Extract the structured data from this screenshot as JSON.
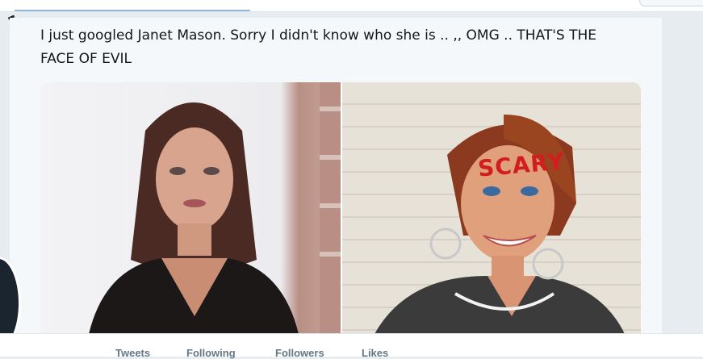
{
  "tweet": {
    "text_line1": "I just googled Janet Mason. Sorry I didn't know who she is .. ,, OMG .. THAT'S THE",
    "text_line2": "FACE OF EVIL",
    "image_overlay_text": "SCARY"
  },
  "profile_nav": {
    "tabs": [
      "Tweets",
      "Following",
      "Followers",
      "Likes"
    ]
  },
  "colors": {
    "page_background": "#e6ecf0",
    "tweet_text": "#14171a",
    "secondary_text": "#657786",
    "overlay_red": "#d11d1d",
    "accent_underline": "#8fb8d9"
  }
}
